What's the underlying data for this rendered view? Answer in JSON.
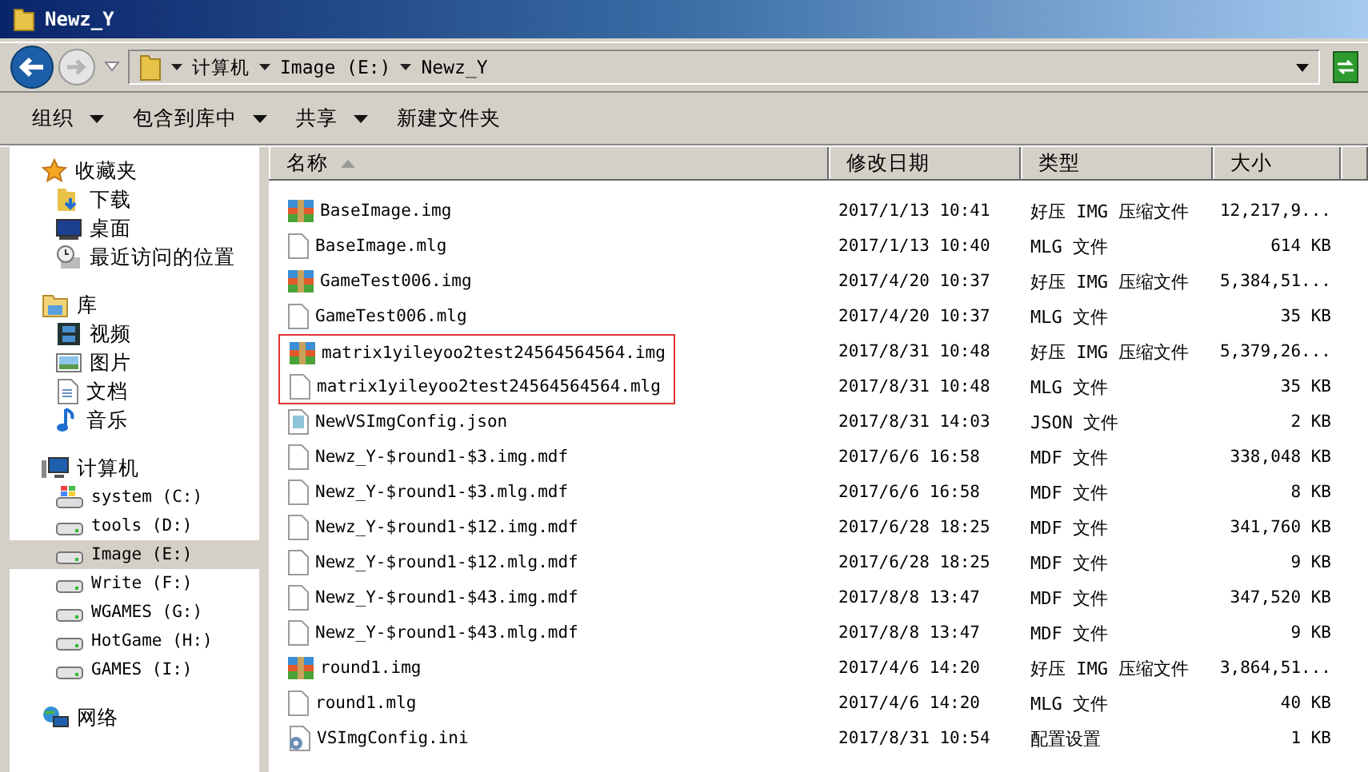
{
  "window": {
    "title": "Newz_Y"
  },
  "address": {
    "segments": [
      "计算机",
      "Image (E:)",
      "Newz_Y"
    ]
  },
  "toolbar": [
    {
      "label": "组织",
      "dropdown": true
    },
    {
      "label": "包含到库中",
      "dropdown": true
    },
    {
      "label": "共享",
      "dropdown": true
    },
    {
      "label": "新建文件夹",
      "dropdown": false
    }
  ],
  "sidebar": {
    "groups": [
      {
        "label": "收藏夹",
        "kind": "favorites",
        "children": [
          {
            "label": "下载",
            "kind": "downloads",
            "selected": false
          },
          {
            "label": "桌面",
            "kind": "desktop",
            "selected": false
          },
          {
            "label": "最近访问的位置",
            "kind": "recent",
            "selected": false
          }
        ]
      },
      {
        "label": "库",
        "kind": "libraries",
        "children": [
          {
            "label": "视频",
            "kind": "video",
            "selected": false
          },
          {
            "label": "图片",
            "kind": "pictures",
            "selected": false
          },
          {
            "label": "文档",
            "kind": "documents",
            "selected": false
          },
          {
            "label": "音乐",
            "kind": "music",
            "selected": false
          }
        ]
      },
      {
        "label": "计算机",
        "kind": "computer",
        "children": [
          {
            "label": "system (C:)",
            "kind": "system-drive",
            "selected": false
          },
          {
            "label": "tools (D:)",
            "kind": "drive",
            "selected": false
          },
          {
            "label": "Image (E:)",
            "kind": "drive",
            "selected": true
          },
          {
            "label": "Write (F:)",
            "kind": "drive",
            "selected": false
          },
          {
            "label": "WGAMES (G:)",
            "kind": "drive",
            "selected": false
          },
          {
            "label": "HotGame (H:)",
            "kind": "drive",
            "selected": false
          },
          {
            "label": "GAMES (I:)",
            "kind": "drive",
            "selected": false
          }
        ]
      },
      {
        "label": "网络",
        "kind": "network"
      }
    ]
  },
  "table": {
    "columns": [
      {
        "label": "名称",
        "sorted": true
      },
      {
        "label": "修改日期",
        "sorted": false
      },
      {
        "label": "类型",
        "sorted": false
      },
      {
        "label": "大小",
        "sorted": false
      }
    ],
    "rows": [
      {
        "kind": "archive",
        "name": "BaseImage.img",
        "date": "2017/1/13 10:41",
        "type": "好压 IMG 压缩文件",
        "size": "12,217,9...",
        "marked": false
      },
      {
        "kind": "blank",
        "name": "BaseImage.mlg",
        "date": "2017/1/13 10:40",
        "type": "MLG 文件",
        "size": "614 KB",
        "marked": false
      },
      {
        "kind": "archive",
        "name": "GameTest006.img",
        "date": "2017/4/20 10:37",
        "type": "好压 IMG 压缩文件",
        "size": "5,384,51...",
        "marked": false
      },
      {
        "kind": "blank",
        "name": "GameTest006.mlg",
        "date": "2017/4/20 10:37",
        "type": "MLG 文件",
        "size": "35 KB",
        "marked": false
      },
      {
        "kind": "archive",
        "name": "matrix1yileyoo2test24564564564.img",
        "date": "2017/8/31 10:48",
        "type": "好压 IMG 压缩文件",
        "size": "5,379,26...",
        "marked": true
      },
      {
        "kind": "blank",
        "name": "matrix1yileyoo2test24564564564.mlg",
        "date": "2017/8/31 10:48",
        "type": "MLG 文件",
        "size": "35 KB",
        "marked": true
      },
      {
        "kind": "json",
        "name": "NewVSImgConfig.json",
        "date": "2017/8/31 14:03",
        "type": "JSON 文件",
        "size": "2 KB",
        "marked": false
      },
      {
        "kind": "blank",
        "name": "Newz_Y-$round1-$3.img.mdf",
        "date": "2017/6/6 16:58",
        "type": "MDF 文件",
        "size": "338,048 KB",
        "marked": false
      },
      {
        "kind": "blank",
        "name": "Newz_Y-$round1-$3.mlg.mdf",
        "date": "2017/6/6 16:58",
        "type": "MDF 文件",
        "size": "8 KB",
        "marked": false
      },
      {
        "kind": "blank",
        "name": "Newz_Y-$round1-$12.img.mdf",
        "date": "2017/6/28 18:25",
        "type": "MDF 文件",
        "size": "341,760 KB",
        "marked": false
      },
      {
        "kind": "blank",
        "name": "Newz_Y-$round1-$12.mlg.mdf",
        "date": "2017/6/28 18:25",
        "type": "MDF 文件",
        "size": "9 KB",
        "marked": false
      },
      {
        "kind": "blank",
        "name": "Newz_Y-$round1-$43.img.mdf",
        "date": "2017/8/8 13:47",
        "type": "MDF 文件",
        "size": "347,520 KB",
        "marked": false
      },
      {
        "kind": "blank",
        "name": "Newz_Y-$round1-$43.mlg.mdf",
        "date": "2017/8/8 13:47",
        "type": "MDF 文件",
        "size": "9 KB",
        "marked": false
      },
      {
        "kind": "archive",
        "name": "round1.img",
        "date": "2017/4/6 14:20",
        "type": "好压 IMG 压缩文件",
        "size": "3,864,51...",
        "marked": false
      },
      {
        "kind": "blank",
        "name": "round1.mlg",
        "date": "2017/4/6 14:20",
        "type": "MLG 文件",
        "size": "40 KB",
        "marked": false
      },
      {
        "kind": "config",
        "name": "VSImgConfig.ini",
        "date": "2017/8/31 10:54",
        "type": "配置设置",
        "size": "1 KB",
        "marked": false
      }
    ]
  }
}
